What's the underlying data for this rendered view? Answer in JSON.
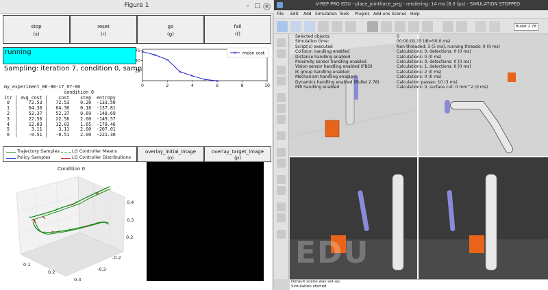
{
  "figure": {
    "title": "Figure 1",
    "buttons": [
      {
        "label": "stop",
        "key": "(s)"
      },
      {
        "label": "reset",
        "key": "(r)"
      },
      {
        "label": "go",
        "key": "(g)"
      },
      {
        "label": "fail",
        "key": "(f)"
      }
    ],
    "status": "running",
    "sampling": "Sampling: iteration 7, condition 0, sample 3.",
    "log": {
      "experiment": "my_experiment_06-08-17_07-06",
      "condition_header": "condition 0",
      "columns": [
        "itr",
        "avg_cost",
        "cost",
        "step",
        "entropy"
      ],
      "rows": [
        [
          "0",
          "72.53",
          "72.53",
          "0.20",
          "-133.50"
        ],
        [
          "1",
          "64.36",
          "64.36",
          "0.18",
          "-137.81"
        ],
        [
          "2",
          "52.37",
          "52.37",
          "0.69",
          "-148.69"
        ],
        [
          "3",
          "22.56",
          "22.56",
          "2.00",
          "-149.57"
        ],
        [
          "4",
          "12.03",
          "12.03",
          "1.65",
          "-178.46"
        ],
        [
          "5",
          "3.11",
          "3.11",
          "2.00",
          "-207.01"
        ],
        [
          "6",
          "-0.51",
          "-0.51",
          "2.00",
          "-221.30"
        ]
      ]
    },
    "lower_buttons": [
      {
        "label": "overlay_initial_image",
        "key": "(o)"
      },
      {
        "label": "overlay_target_image",
        "key": "(p)"
      }
    ],
    "trajectory_legend": [
      {
        "label": "Trajectory Samples",
        "color": "#1a8a1a"
      },
      {
        "label": "LG Controller Means",
        "color": "#1a8a1a"
      },
      {
        "label": "Policy Samples",
        "color": "#1f3fd0"
      },
      {
        "label": "LG Controller Distributions",
        "color": "#cc1a1a"
      }
    ],
    "plot3d": {
      "title": "Condition 0",
      "x_ticks": [
        "0.1",
        "0.2",
        "0.3"
      ],
      "y_ticks": [
        "-0.2",
        "-0.3"
      ],
      "z_ticks": [
        "0.4",
        "0.3",
        "0.2"
      ]
    }
  },
  "chart_data": {
    "type": "line",
    "x": [
      0,
      1,
      2,
      3,
      4,
      5,
      6
    ],
    "series": [
      {
        "name": "mean cost",
        "values": [
          72.53,
          64.36,
          52.37,
          22.56,
          12.03,
          3.11,
          -0.51
        ]
      }
    ],
    "xlim": [
      0,
      10
    ],
    "ylim": [
      0,
      75
    ],
    "x_ticks": [
      "0",
      "2",
      "4",
      "6",
      "8",
      "10"
    ],
    "y_ticks": [
      "75",
      "50",
      "25"
    ],
    "legend": "top-right",
    "color": "#1f1fbf"
  },
  "vrep": {
    "title": "V-REP PRO EDU - place_jointforce_peg - rendering: 14 ms (8.0 fps) - SIMULATION STOPPED",
    "menus": [
      "File",
      "Edit",
      "Add",
      "Simulation",
      "Tools",
      "Plugins",
      "Add-ons",
      "Scenes",
      "Help"
    ],
    "engine": "Bullet 2.78",
    "info": [
      {
        "k": "Selected objects:",
        "v": "0"
      },
      {
        "k": "Simulation time:",
        "v": "00:00:00.15 (dt=50.0 ms)"
      },
      {
        "k": "Script(s) executed",
        "v": "Non-threaded: 3 (5 ms), running threads: 0 (0 ms)"
      },
      {
        "k": "Collision handling enabled",
        "v": "Calculations: 0, detections: 0 (0 ms)"
      },
      {
        "k": "Distance handling enabled",
        "v": "Calculations: 0 (0 ms)"
      },
      {
        "k": "Proximity sensor handling enabled",
        "v": "Calculations: 0, detections: 0 (0 ms)"
      },
      {
        "k": "Vision sensor handling enabled (FBO)",
        "v": "Calculations: 1, detections: 0 (0 ms)"
      },
      {
        "k": "IK group handling enabled",
        "v": "Calculations: 2 (0 ms)"
      },
      {
        "k": "Mechanism handling enabled",
        "v": "Calculations: 0 (0 ms)"
      },
      {
        "k": "Dynamics handling enabled (Bullet 2.78)",
        "v": "Calculation passes: 10 (3 ms)"
      },
      {
        "k": "Mill handling enabled",
        "v": "Calculations: 0, surface cut: 0 mm^2 (0 ms)"
      }
    ],
    "watermark": "EDU",
    "status_lines": [
      "Default scene was set-up.",
      "Simulation started."
    ]
  },
  "colors": {
    "running_bg": "#00ffff",
    "cube": "#e8641a",
    "robot": "#e8e8e8",
    "peg": "#8a8ad8"
  }
}
